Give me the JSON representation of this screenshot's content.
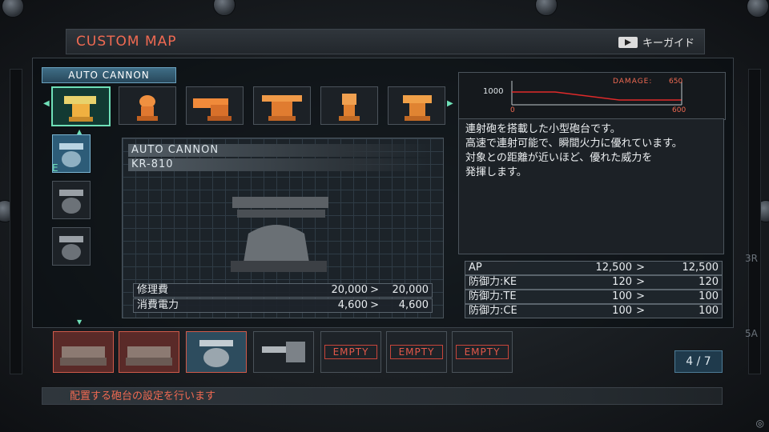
{
  "header": {
    "title": "CUSTOM MAP",
    "key_guide": "キーガイド"
  },
  "category_tab": "AUTO CANNON",
  "turret_thumbs": [
    {
      "name": "turret-1",
      "selected": true
    },
    {
      "name": "turret-2",
      "selected": false
    },
    {
      "name": "turret-3",
      "selected": false
    },
    {
      "name": "turret-4",
      "selected": false
    },
    {
      "name": "turret-5",
      "selected": false
    },
    {
      "name": "turret-6",
      "selected": false
    }
  ],
  "variant_label": "E",
  "detail": {
    "name": "AUTO CANNON",
    "model": "KR-810",
    "stats": [
      {
        "label": "修理費",
        "current": "20,000",
        "arrow": ">",
        "new": "20,000"
      },
      {
        "label": "消費電力",
        "current": "4,600",
        "arrow": ">",
        "new": "4,600"
      }
    ]
  },
  "graph": {
    "damage_label": "DAMAGE:",
    "damage_value": "650",
    "y_tick": "1000",
    "x_min": "0",
    "x_max": "600"
  },
  "description": [
    "連射砲を搭載した小型砲台です。",
    "高速で連射可能で、瞬間火力に優れています。",
    "対象との距離が近いほど、優れた威力を",
    "発揮します。"
  ],
  "specs": [
    {
      "label": "AP",
      "current": "12,500",
      "arrow": ">",
      "new": "12,500"
    },
    {
      "label": "防御力:KE",
      "current": "120",
      "arrow": ">",
      "new": "120"
    },
    {
      "label": "防御力:TE",
      "current": "100",
      "arrow": ">",
      "new": "100"
    },
    {
      "label": "防御力:CE",
      "current": "100",
      "arrow": ">",
      "new": "100"
    }
  ],
  "slots": [
    {
      "type": "tank"
    },
    {
      "type": "tank"
    },
    {
      "type": "turret"
    },
    {
      "type": "cannon"
    },
    {
      "type": "empty",
      "label": "EMPTY"
    },
    {
      "type": "empty",
      "label": "EMPTY"
    },
    {
      "type": "empty",
      "label": "EMPTY"
    }
  ],
  "page_indicator": "4 / 7",
  "hint": "配置する砲台の設定を行います",
  "side_labels": {
    "r": "3R",
    "a": "5A"
  },
  "colors": {
    "accent_red": "#f06a52",
    "accent_green": "#6fe0b8"
  }
}
